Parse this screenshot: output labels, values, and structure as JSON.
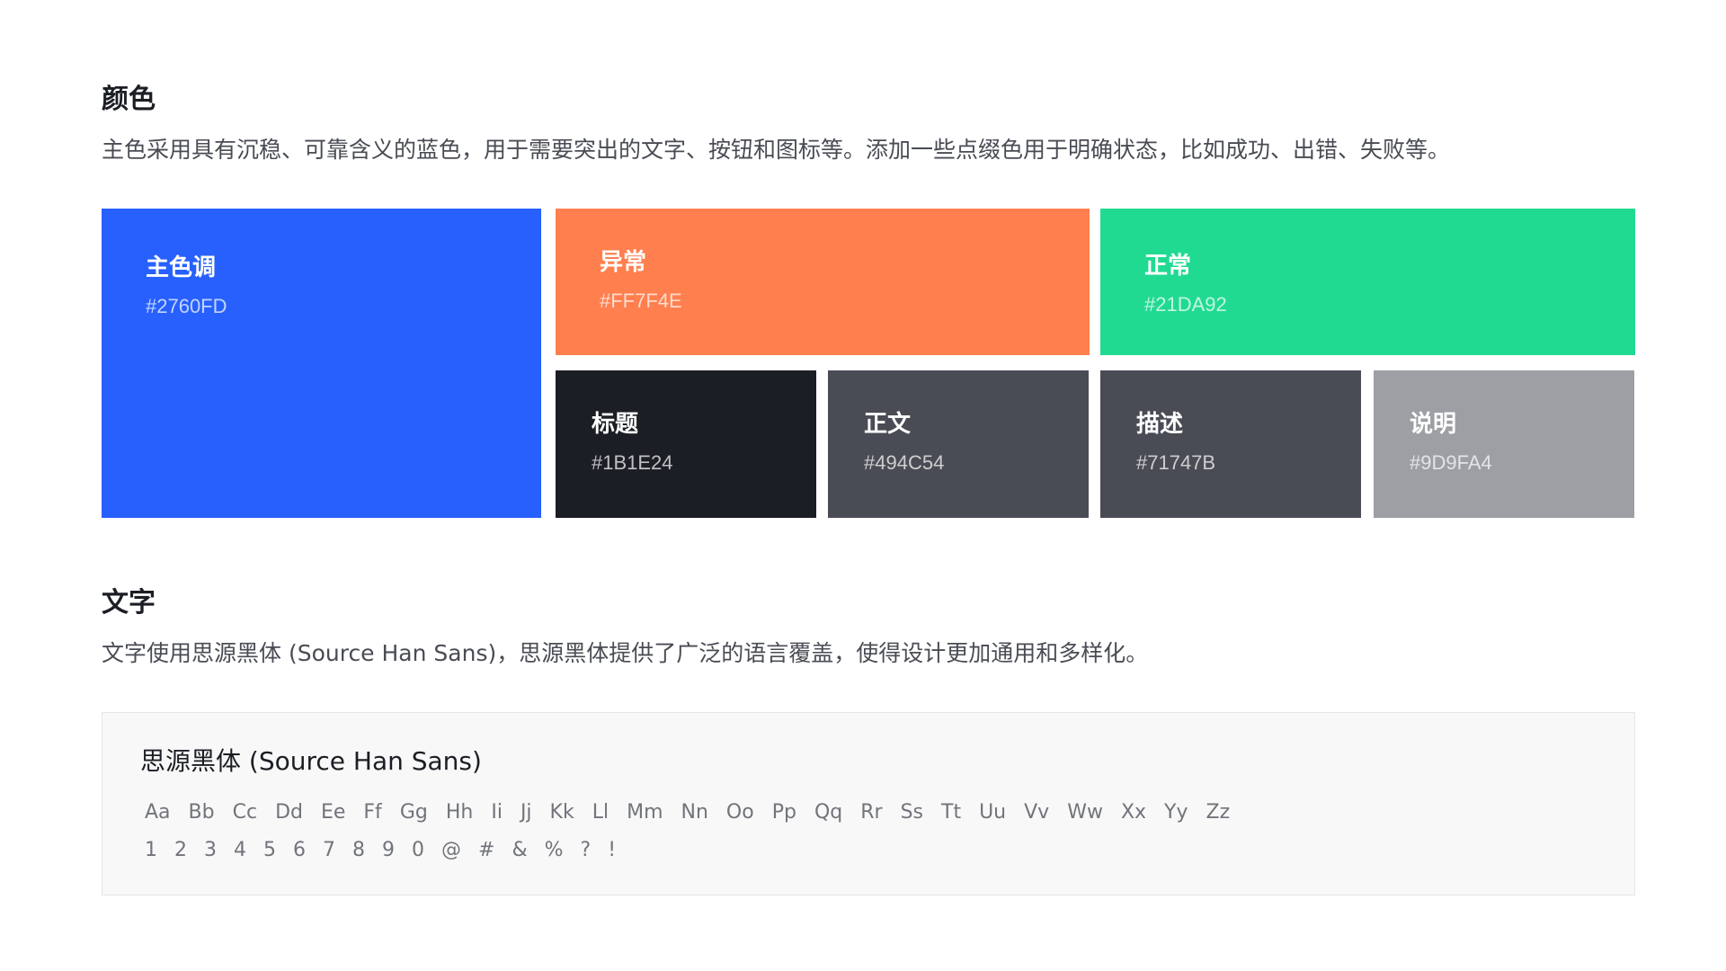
{
  "colors_section": {
    "title": "颜色",
    "description": "主色采用具有沉稳、可靠含义的蓝色，用于需要突出的文字、按钮和图标等。添加一些点缀色用于明确状态，比如成功、出错、失败等。",
    "swatches": [
      {
        "name": "主色调",
        "hex": "#2760FD",
        "color": "#2760FD"
      },
      {
        "name": "异常",
        "hex": "#FF7F4E",
        "color": "#FF7F4E"
      },
      {
        "name": "正常",
        "hex": "#21DA92",
        "color": "#21DA92"
      },
      {
        "name": "标题",
        "hex": "#1B1E24",
        "color": "#1B1E24"
      },
      {
        "name": "正文",
        "hex": "#494C54",
        "color": "#494C54"
      },
      {
        "name": "描述",
        "hex": "#71747B",
        "color": "#494C54"
      },
      {
        "name": "说明",
        "hex": "#9D9FA4",
        "color": "#9D9FA4"
      }
    ]
  },
  "text_section": {
    "title": "文字",
    "description": "文字使用思源黑体 (Source Han Sans)，思源黑体提供了广泛的语言覆盖，使得设计更加通用和多样化。",
    "font_sample": {
      "name": "思源黑体 (Source Han Sans)",
      "letters": [
        "Aa",
        "Bb",
        "Cc",
        "Dd",
        "Ee",
        "Ff",
        "Gg",
        "Hh",
        "Ii",
        "Jj",
        "Kk",
        "Ll",
        "Mm",
        "Nn",
        "Oo",
        "Pp",
        "Qq",
        "Rr",
        "Ss",
        "Tt",
        "Uu",
        "Vv",
        "Ww",
        "Xx",
        "Yy",
        "Zz"
      ],
      "digits": [
        "1",
        "2",
        "3",
        "4",
        "5",
        "6",
        "7",
        "8",
        "9",
        "0",
        "@",
        "#",
        "&",
        "%",
        "?",
        "!"
      ]
    }
  }
}
